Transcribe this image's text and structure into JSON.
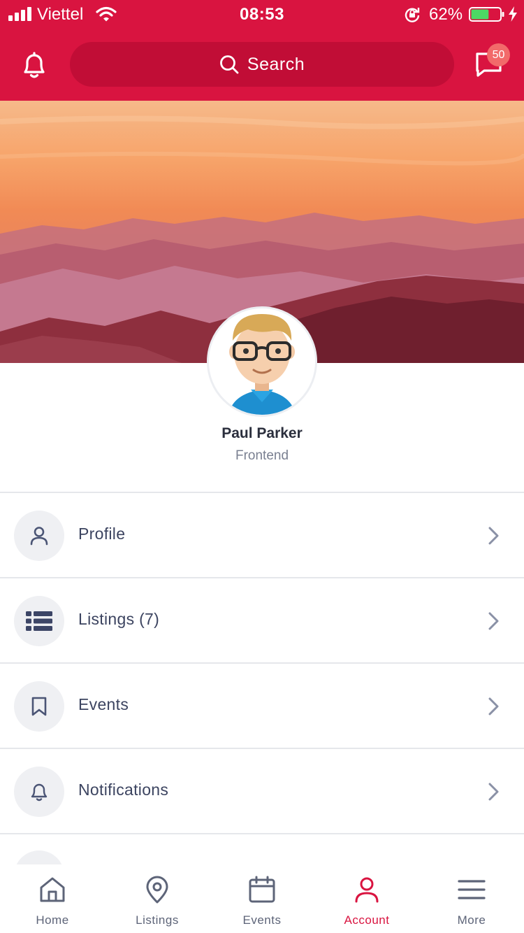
{
  "status_bar": {
    "carrier": "Viettel",
    "time": "08:53",
    "battery_percent": "62%",
    "battery_level": 0.62,
    "icons": [
      "signal-icon",
      "wifi-icon",
      "rotation-lock-icon",
      "battery-icon",
      "charging-icon"
    ]
  },
  "header": {
    "search_label": "Search",
    "message_badge": "50",
    "colors": {
      "primary": "#d91440",
      "search_bg": "#c10d36",
      "badge": "#f26a6a"
    }
  },
  "profile": {
    "name": "Paul Parker",
    "role": "Frontend"
  },
  "menu": [
    {
      "label": "Profile",
      "icon": "user-icon"
    },
    {
      "label": "Listings (7)",
      "icon": "list-icon"
    },
    {
      "label": "Events",
      "icon": "bookmark-icon"
    },
    {
      "label": "Notifications",
      "icon": "bell-icon"
    }
  ],
  "tabs": [
    {
      "label": "Home",
      "icon": "home-icon",
      "active": false
    },
    {
      "label": "Listings",
      "icon": "map-pin-icon",
      "active": false
    },
    {
      "label": "Events",
      "icon": "calendar-icon",
      "active": false
    },
    {
      "label": "Account",
      "icon": "user-icon",
      "active": true
    },
    {
      "label": "More",
      "icon": "menu-icon",
      "active": false
    }
  ]
}
